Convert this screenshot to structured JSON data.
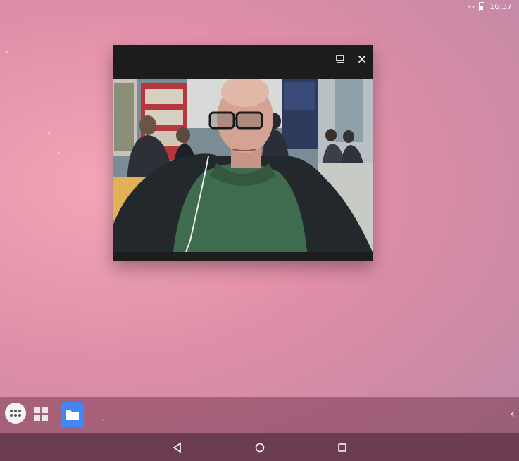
{
  "status_bar": {
    "data_indicator": "‹··›",
    "time": "16:37"
  },
  "window": {
    "maximize_icon": "maximize-icon",
    "close_icon": "close-icon",
    "content": "camera-preview"
  },
  "dock": {
    "apps": [
      {
        "name": "app-drawer",
        "icon": "dots-grid-icon"
      },
      {
        "name": "apps-grid",
        "icon": "grid-icon"
      },
      {
        "name": "files",
        "icon": "folder-icon",
        "color": "#4285f4"
      }
    ],
    "expand_icon": "‹"
  },
  "nav": {
    "back_icon": "back-triangle-icon",
    "home_icon": "home-circle-icon",
    "recents_icon": "recents-square-icon"
  },
  "colors": {
    "wallpaper": "#e08ea8",
    "window_bg": "#1c1c1c",
    "navbar": "#6b3b52",
    "files_blue": "#4285f4"
  }
}
